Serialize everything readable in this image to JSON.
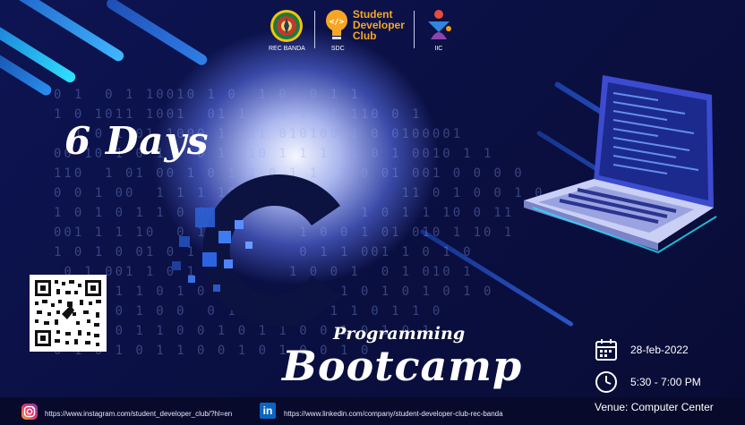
{
  "header": {
    "logos": [
      {
        "name": "rec-banda-emblem",
        "caption": "REC BANDA"
      },
      {
        "name": "sdc-bulb-logo",
        "title_lines": [
          "Student",
          "Developer",
          "Club"
        ],
        "caption": "SDC"
      },
      {
        "name": "iic-logo",
        "caption": "IIC"
      }
    ]
  },
  "hero": {
    "title_top": "6 Days",
    "subtitle": "Programming",
    "title_bottom": "Bootcamp",
    "logo_letter": "C"
  },
  "event": {
    "date": "28-feb-2022",
    "time": "5:30 - 7:00 PM",
    "venue": "Venue: Computer Center"
  },
  "footer": {
    "instagram_url": "https://www.instagram.com/student_developer_club/?hl=en",
    "linkedin_url": "https://www.linkedin.com/company/student-developer-club-rec-banda",
    "linkedin_badge": "in"
  },
  "binary_lines": [
    "0 1  0 1 10010 1 0  1 0  0 1 1",
    "1 0 1011 1001  01 1  11 1 01 110 0 1",
    "  1 0 1 01 1000 1  11 010100 1 0 0100001",
    "00 10 1 0 1   0 1  10 1 1 1  1 0 1 0010 1 1",
    "110  1 01 00 1 0 1 1 0 1 1  1 0 01 001 0 0 0 0",
    "0 0 1 00  1 1 1 10 1 0 0 1 0      11 0 1 0 0 1 0",
    "1 0 1 0 1 1 0 0  1      0 1   1 0 1 1 10 0 11",
    "001 1 1 10  0 1         1 0 0 1 01 010 1 10 1",
    "1 0 1 0 01 0 1          0 1 1 001 1 0 1 0",
    " 0 1 001 1 0 1         1 0 0 1  0 1 010 1",
    "1 0 0 1 1 0 1 0 1 0       0 1 0 1 0 1 0 1 0",
    "0 1 1 0 1 0 0  0 1 1 0 1 0 1 1 0 1 1 0",
    "  1 0 0 1 1 0 0 1 0 1 1 0 0 1 0 1 0 1",
    "0 1 0 1 0 1 1 0 0 1 0 1 0 0 1 0"
  ]
}
